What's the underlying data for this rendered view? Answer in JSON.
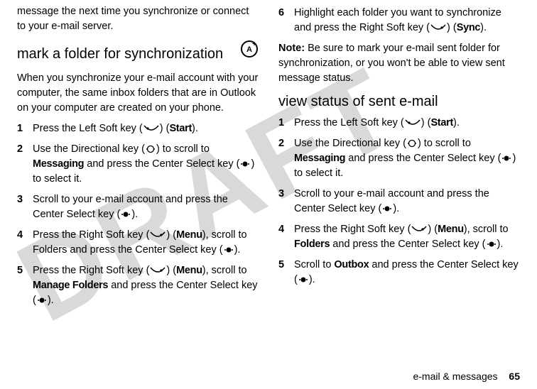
{
  "left": {
    "intro_continued": "message the next time you synchronize or connect to your e-mail server.",
    "section_title": "mark a folder for synchronization",
    "section_intro": "When you synchronize your e-mail account with your computer, the same inbox folders that are in Outlook on your computer are created on your phone.",
    "steps": [
      {
        "n": "1",
        "pre": "Press the Left Soft key (",
        "mid": ") (",
        "label": "Start",
        "post": ")."
      },
      {
        "n": "2",
        "pre": "Use the Directional key (",
        "mid": ") to scroll to ",
        "label": "Messaging",
        "post2": " and press the Center Select key (",
        "post3": ") to select it."
      },
      {
        "n": "3",
        "pre": "Scroll to your e-mail account and press the Center Select key (",
        "post": ")."
      },
      {
        "n": "4",
        "pre": "Press the Right Soft key (",
        "mid": ") (",
        "label": "Menu",
        "post": "), scroll to Folders and press the Center Select key (",
        "post2": ")."
      },
      {
        "n": "5",
        "pre": "Press the Right Soft key (",
        "mid": ") (",
        "label": "Menu",
        "post": "), scroll to ",
        "label2": "Manage Folders",
        "post2": " and press the Center Select key (",
        "post3": ")."
      }
    ]
  },
  "right": {
    "step6": {
      "n": "6",
      "pre": "Highlight each folder you want to synchronize and press the Right Soft key (",
      "mid": ") (",
      "label": "Sync",
      "post": ")."
    },
    "note_label": "Note:",
    "note_body": " Be sure to mark your e-mail sent folder for synchronization, or you won't be able to view sent message status.",
    "section_title": "view status of sent e-mail",
    "steps": [
      {
        "n": "1",
        "pre": "Press the Left Soft key (",
        "mid": ") (",
        "label": "Start",
        "post": ")."
      },
      {
        "n": "2",
        "pre": "Use the Directional key (",
        "mid": ") to scroll to ",
        "label": "Messaging",
        "post2": " and press the Center Select key (",
        "post3": ") to select it."
      },
      {
        "n": "3",
        "pre": "Scroll to your e-mail account and press the Center Select key (",
        "post": ")."
      },
      {
        "n": "4",
        "pre": "Press the Right Soft key (",
        "mid": ") (",
        "label": "Menu",
        "post": "), scroll to ",
        "label2": "Folders",
        "post2": " and press the Center Select key (",
        "post3": ")."
      },
      {
        "n": "5",
        "pre": "Scroll to ",
        "label": "Outbox",
        "post": " and press the Center Select key (",
        "post2": ")."
      }
    ]
  },
  "footer": {
    "section": "e-mail & messages",
    "page": "65"
  }
}
